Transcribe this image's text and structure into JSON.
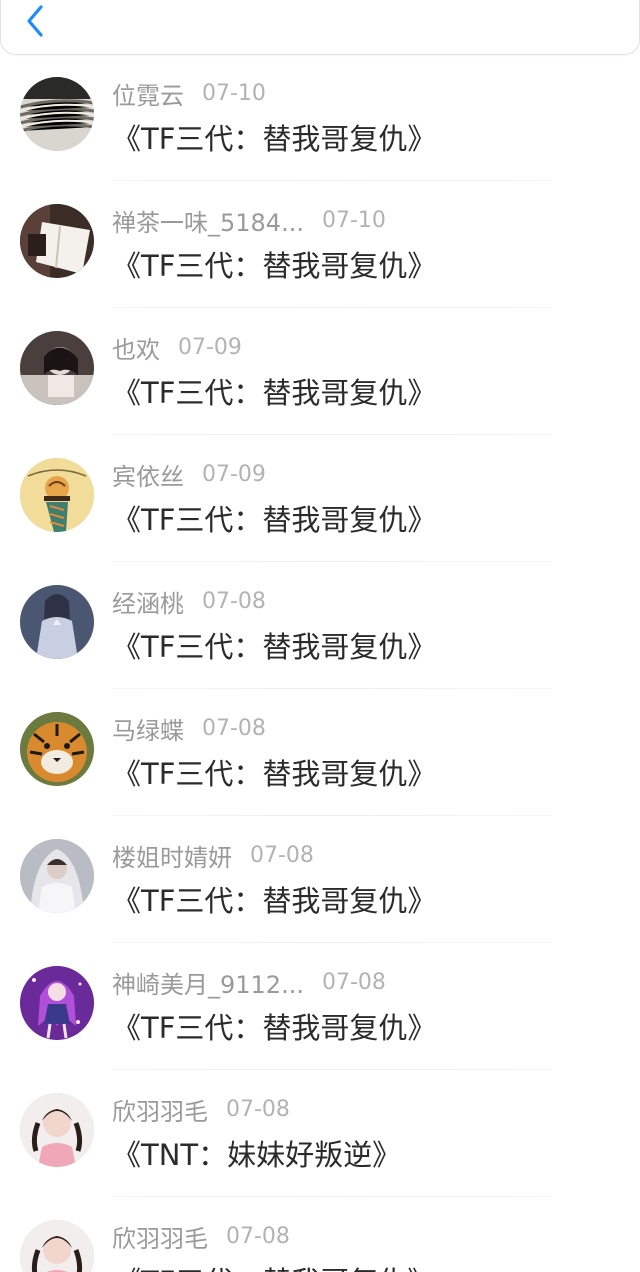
{
  "topbar": {
    "back_icon": "chevron-left-icon",
    "accent_color": "#1a8cff"
  },
  "entries": [
    {
      "name": "位霓云",
      "date": "07-10",
      "title": "《TF三代：替我哥复仇》",
      "avatar": "striped-fabric"
    },
    {
      "name": "禅茶一味_5184...",
      "date": "07-10",
      "title": "《TF三代：替我哥复仇》",
      "avatar": "book-on-desk"
    },
    {
      "name": "也欢",
      "date": "07-09",
      "title": "《TF三代：替我哥复仇》",
      "avatar": "dark-girl-photo"
    },
    {
      "name": "宾依丝",
      "date": "07-09",
      "title": "《TF三代：替我哥复仇》",
      "avatar": "sagittarius-cartoon"
    },
    {
      "name": "经涵桃",
      "date": "07-08",
      "title": "《TF三代：替我哥复仇》",
      "avatar": "praying-girl-illustration"
    },
    {
      "name": "马绿蝶",
      "date": "07-08",
      "title": "《TF三代：替我哥复仇》",
      "avatar": "tiger"
    },
    {
      "name": "楼姐时婧妍",
      "date": "07-08",
      "title": "《TF三代：替我哥复仇》",
      "avatar": "veiled-woman"
    },
    {
      "name": "神崎美月_9112...",
      "date": "07-08",
      "title": "《TF三代：替我哥复仇》",
      "avatar": "purple-anime-girl"
    },
    {
      "name": "欣羽羽毛",
      "date": "07-08",
      "title": "《TNT：妹妹好叛逆》",
      "avatar": "little-girl-pigtails"
    },
    {
      "name": "欣羽羽毛",
      "date": "07-08",
      "title": "《TF三代：替我哥复仇》",
      "avatar": "little-girl-pigtails"
    }
  ]
}
